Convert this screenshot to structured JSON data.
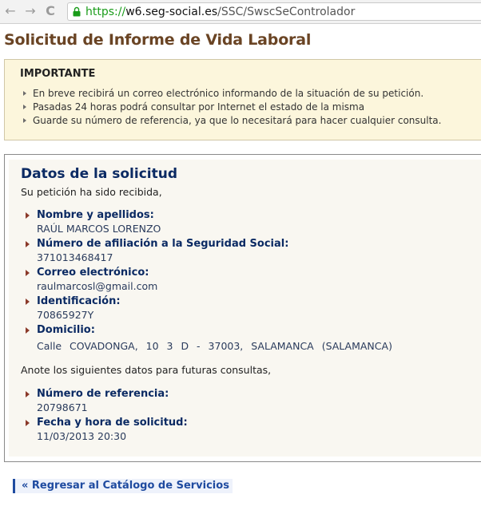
{
  "browser": {
    "back_glyph": "←",
    "forward_glyph": "→",
    "reload_glyph": "C",
    "url_scheme": "https://",
    "url_host": "w6.seg-social.es",
    "url_path": "/SSC/SwscSeControlador",
    "lock_color": "#1a9c1a"
  },
  "page": {
    "title": "Solicitud de Informe de Vida Laboral"
  },
  "notice": {
    "heading": "IMPORTANTE",
    "items": [
      "En breve recibirá un correo electrónico informando de la situación de su petición.",
      "Pasadas 24 horas podrá consultar por Internet el estado de la misma",
      "Guarde su número de referencia, ya que lo necesitará para hacer cualquier consulta."
    ]
  },
  "request": {
    "heading": "Datos de la solicitud",
    "intro": "Su petición ha sido recibida,",
    "fields": [
      {
        "label": "Nombre y apellidos:",
        "value": "RAÚL MARCOS LORENZO"
      },
      {
        "label": "Número de afiliación a la Seguridad Social:",
        "value": "371013468417"
      },
      {
        "label": "Correo electrónico:",
        "value": "raulmarcosl@gmail.com"
      },
      {
        "label": "Identificación:",
        "value": "70865927Y"
      },
      {
        "label": "Domicilio:",
        "value": "Calle COVADONGA, 10 3 D - 37003, SALAMANCA (SALAMANCA)"
      }
    ],
    "note": "Anote los siguientes datos para futuras consultas,",
    "reference": {
      "label": "Número de referencia:",
      "value": "20798671"
    },
    "datetime": {
      "label": "Fecha y hora de solicitud:",
      "value": "11/03/2013 20:30"
    }
  },
  "footer": {
    "back_link": "« Regresar al Catálogo de Servicios"
  },
  "colors": {
    "title_brown": "#6a4424",
    "heading_navy": "#0b2a63",
    "bullet_red": "#8b3a2a",
    "notice_bg": "#fcf6dc",
    "link_blue": "#1f4ba0"
  }
}
